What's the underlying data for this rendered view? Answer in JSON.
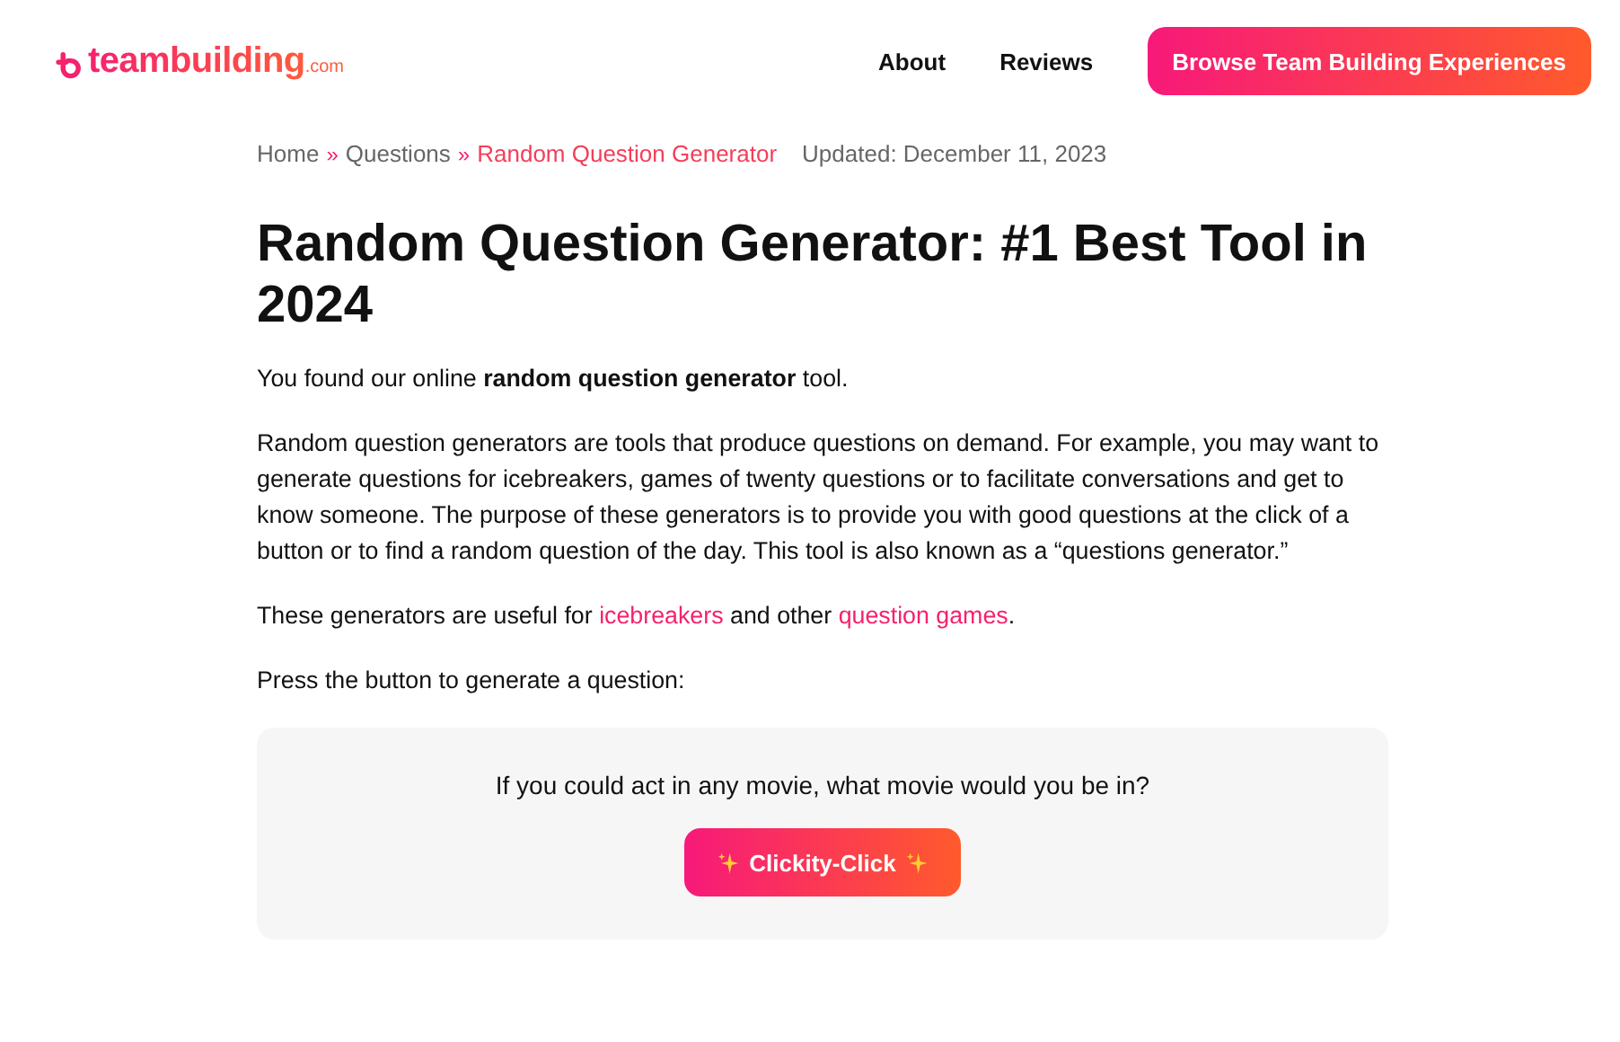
{
  "header": {
    "logo": {
      "name": "teambuilding",
      "suffix": ".com"
    },
    "nav": [
      "About",
      "Reviews"
    ],
    "cta": "Browse Team Building Experiences"
  },
  "breadcrumb": {
    "items": [
      {
        "label": "Home",
        "selected": false
      },
      {
        "label": "Questions",
        "selected": false
      },
      {
        "label": "Random Question Generator",
        "selected": true
      }
    ],
    "separator": "»",
    "updated": "Updated: December 11, 2023"
  },
  "title": "Random Question Generator: #1 Best Tool in 2024",
  "paragraphs": [
    [
      {
        "kind": "text",
        "text": "You found our online **random question generator** tool."
      }
    ],
    [
      {
        "kind": "text",
        "text": "Random question generators are tools that produce questions on demand. For example, you may want to generate questions for icebreakers, games of twenty questions or to facilitate conversations and get to know someone. The purpose of these generators is to provide you with good questions at the click of a button or to find a random question of the day. This tool is also known as a “questions generator.”"
      }
    ],
    [
      {
        "kind": "text",
        "text": "These generators are useful for "
      },
      {
        "kind": "link",
        "text": "icebreakers"
      },
      {
        "kind": "text",
        "text": " and other "
      },
      {
        "kind": "link",
        "text": "question games"
      },
      {
        "kind": "text",
        "text": "."
      }
    ],
    [
      {
        "kind": "text",
        "text": "Press the button to generate a question:"
      }
    ]
  ],
  "generator": {
    "question": "If you could act in any movie, what movie would you be in?",
    "button": "Clickity-Click"
  }
}
